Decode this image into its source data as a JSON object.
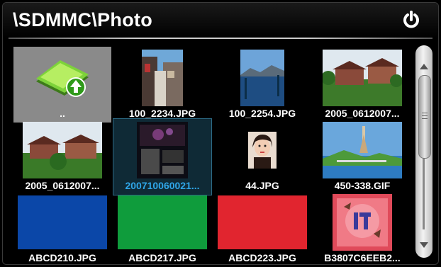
{
  "header": {
    "title": "\\SDMMC\\Photo",
    "icons": {
      "power": "power-icon"
    }
  },
  "files": [
    {
      "label": "..",
      "kind": "up-folder"
    },
    {
      "label": "100_2234.JPG",
      "kind": "photo"
    },
    {
      "label": "100_2254.JPG",
      "kind": "photo"
    },
    {
      "label": "2005_0612007...",
      "kind": "photo"
    },
    {
      "label": "2005_0612007...",
      "kind": "photo"
    },
    {
      "label": "200710060021...",
      "kind": "photo",
      "selected": true
    },
    {
      "label": "44.JPG",
      "kind": "photo"
    },
    {
      "label": "450-338.GIF",
      "kind": "photo"
    },
    {
      "label": "ABCD210.JPG",
      "kind": "color",
      "color": "#0b47a8"
    },
    {
      "label": "ABCD217.JPG",
      "kind": "color",
      "color": "#0f9c3c"
    },
    {
      "label": "ABCD223.JPG",
      "kind": "color",
      "color": "#e1252f"
    },
    {
      "label": "B3807C6EEB2...",
      "kind": "photo"
    }
  ],
  "colors": {
    "background": "#000000",
    "selected_label": "#2fa6e8"
  },
  "scrollbar": {
    "position": "top"
  }
}
